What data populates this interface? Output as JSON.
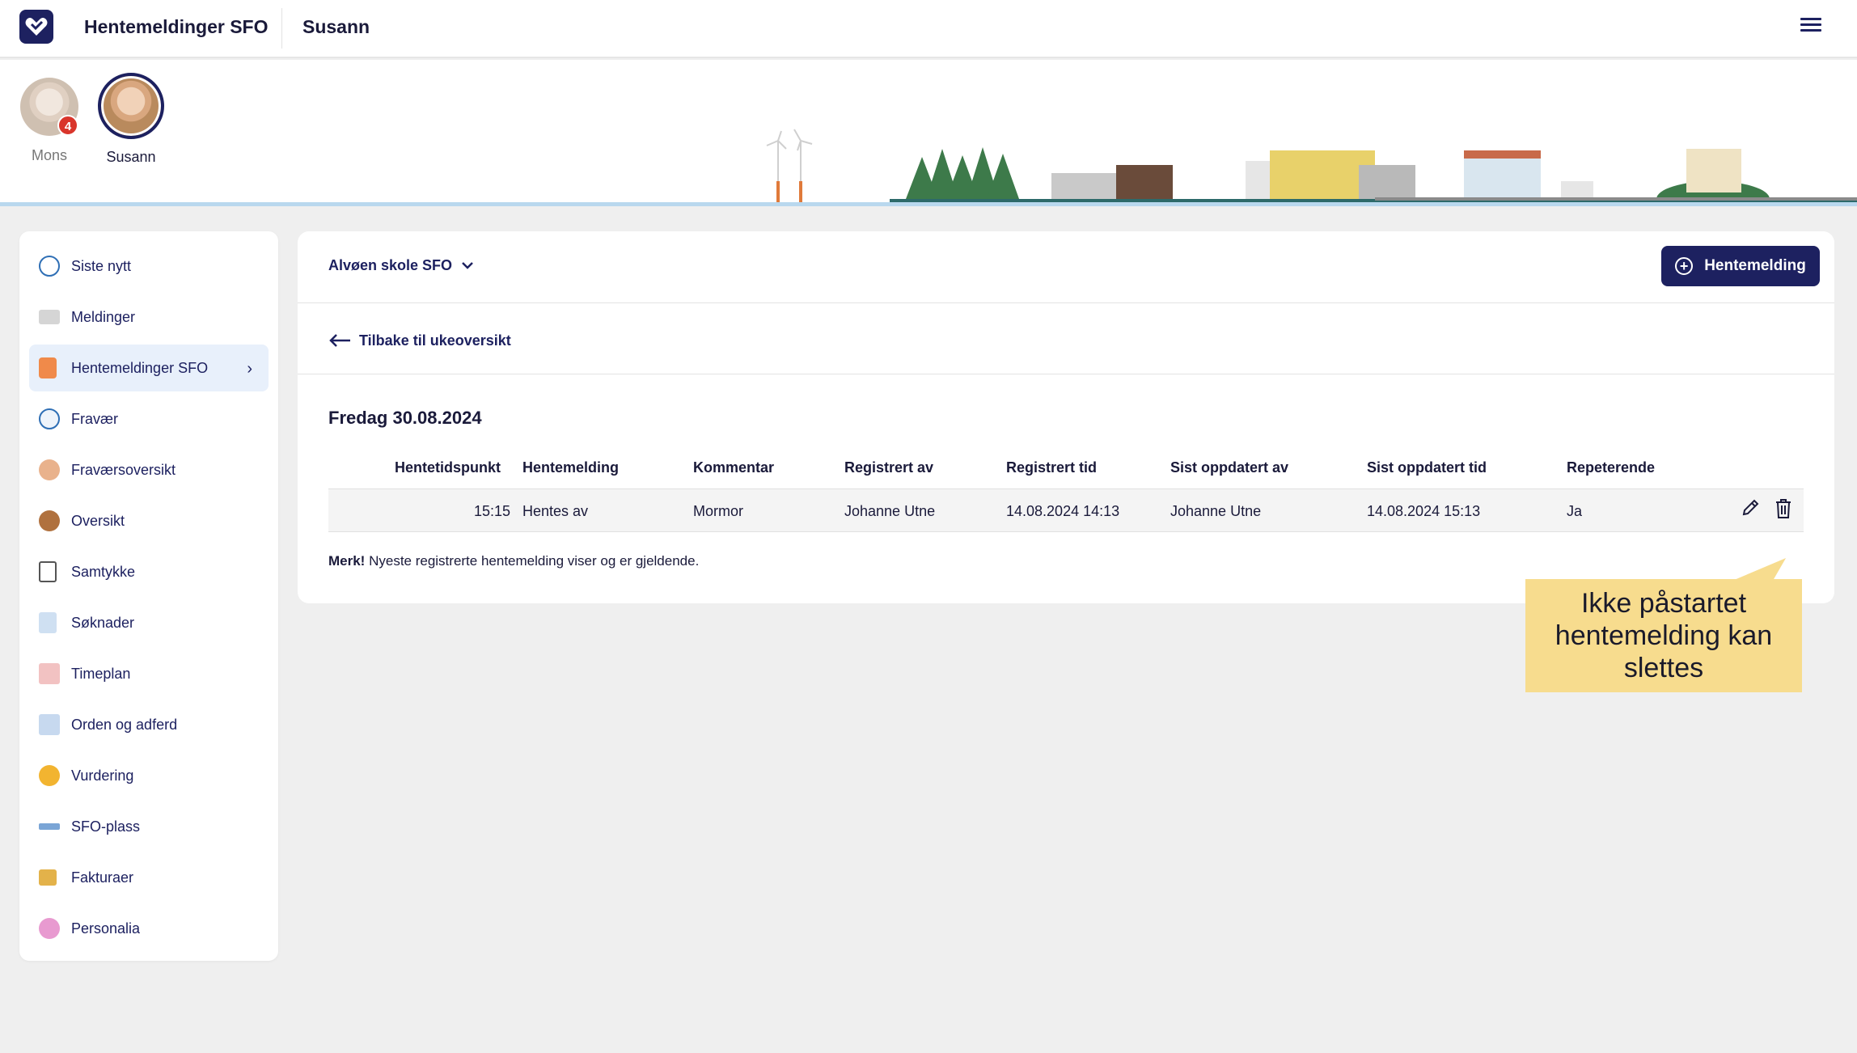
{
  "topbar": {
    "app_title": "Hentemeldinger SFO",
    "child_title": "Susann",
    "logo_icon": "heart-logo-icon",
    "menu_icon": "hamburger-icon"
  },
  "children": [
    {
      "name": "Mons",
      "badge": "4"
    },
    {
      "name": "Susann"
    }
  ],
  "sidebar": {
    "items": [
      {
        "label": "Siste nytt",
        "icon": "news-icon"
      },
      {
        "label": "Meldinger",
        "icon": "envelope-icon"
      },
      {
        "label": "Hentemeldinger SFO",
        "icon": "pickup-icon"
      },
      {
        "label": "Fravær",
        "icon": "clock-icon"
      },
      {
        "label": "Fraværsoversikt",
        "icon": "absence-overview-icon"
      },
      {
        "label": "Oversikt",
        "icon": "person-icon"
      },
      {
        "label": "Samtykke",
        "icon": "clipboard-icon"
      },
      {
        "label": "Søknader",
        "icon": "search-document-icon"
      },
      {
        "label": "Timeplan",
        "icon": "calendar-icon"
      },
      {
        "label": "Orden og adferd",
        "icon": "conduct-icon"
      },
      {
        "label": "Vurdering",
        "icon": "medal-icon"
      },
      {
        "label": "SFO-plass",
        "icon": "seesaw-icon"
      },
      {
        "label": "Fakturaer",
        "icon": "coins-icon"
      },
      {
        "label": "Personalia",
        "icon": "fingerprint-icon"
      }
    ],
    "active_chevron": "›"
  },
  "main": {
    "school": "Alvøen skole SFO",
    "new_button": "Hentemelding",
    "back_link": "Tilbake til ukeoversikt",
    "date_title": "Fredag 30.08.2024",
    "table": {
      "headers": [
        "Hentetidspunkt",
        "Hentemelding",
        "Kommentar",
        "Registrert av",
        "Registrert tid",
        "Sist oppdatert av",
        "Sist oppdatert tid",
        "Repeterende"
      ],
      "rows": [
        [
          "15:15",
          "Hentes av",
          "Mormor",
          "Johanne Utne",
          "14.08.2024 14:13",
          "Johanne Utne",
          "14.08.2024 15:13",
          "Ja"
        ]
      ]
    },
    "note_bold": "Merk!",
    "note_text": " Nyeste registrerte hentemelding viser og er gjeldende."
  },
  "callout": {
    "line1": "Ikke påstartet",
    "line2": "hentemelding kan",
    "line3": "slettes"
  },
  "colors": {
    "primary": "#1d2160",
    "active_bg": "#e8f0fb",
    "badge": "#d9352b",
    "callout": "#f7dc8e"
  }
}
